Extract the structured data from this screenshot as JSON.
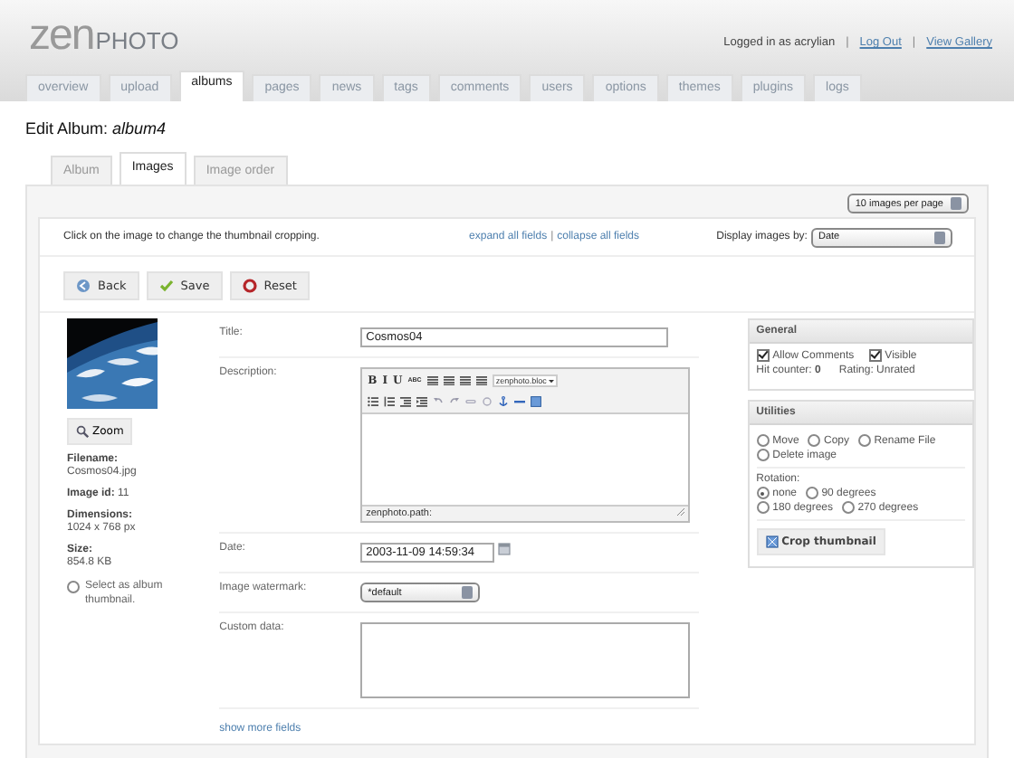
{
  "header": {
    "logo_light": "zen",
    "logo_bold": "PHOTO",
    "user_text": "Logged in as acrylian",
    "links": [
      {
        "separator": "|",
        "label": "Log Out"
      },
      {
        "separator": "|",
        "label": "View Gallery"
      }
    ]
  },
  "main_tabs": [
    {
      "label": "overview",
      "selected": false
    },
    {
      "label": "upload",
      "selected": false
    },
    {
      "label": "albums",
      "selected": true
    },
    {
      "label": "pages",
      "selected": false
    },
    {
      "label": "news",
      "selected": false
    },
    {
      "label": "tags",
      "selected": false
    },
    {
      "label": "comments",
      "selected": false
    },
    {
      "label": "users",
      "selected": false
    },
    {
      "label": "options",
      "selected": false
    },
    {
      "label": "themes",
      "selected": false
    },
    {
      "label": "plugins",
      "selected": false
    },
    {
      "label": "logs",
      "selected": false
    }
  ],
  "page_title": "Edit Album: *album4*",
  "sub_tabs": [
    {
      "label": "Album",
      "selected": false
    },
    {
      "label": "Images",
      "selected": true
    },
    {
      "label": "Image order",
      "selected": false
    }
  ],
  "per_page": "10 images per page",
  "instructions": "Click on the image to change the thumbnail cropping.",
  "field_links": [
    {
      "label": "expand all fields"
    },
    {
      "separator": "|",
      "label": "collapse all fields"
    }
  ],
  "display_by": {
    "label": "Display images by:",
    "value": "Date"
  },
  "buttons": [
    {
      "label": "Back",
      "kind": "back"
    },
    {
      "label": "Save",
      "kind": "save"
    },
    {
      "label": "Reset",
      "kind": "reset"
    }
  ],
  "image": {
    "kind": "picture",
    "zoom": "Zoom",
    "info": [
      {
        "label": "Filename:",
        "value": "Cosmos04.jpg",
        "inline": false
      },
      {
        "label": "Image id:",
        "value": "11",
        "inline": true
      },
      {
        "label": "Dimensions:",
        "value": "1024 x 768 px",
        "inline": false
      },
      {
        "label": "Size:",
        "value": "854.8 KB",
        "inline": false
      }
    ],
    "thumbnail_option": {
      "label": "Select as album thumbnail.",
      "selected": false
    }
  },
  "fields": [
    {
      "kind": "text",
      "label": "Title:",
      "value": "Cosmos04"
    },
    {
      "kind": "editor",
      "label": "Description:",
      "toolbar_text": [
        "B",
        "I",
        "U",
        "ABC"
      ],
      "format": "zenphoto.bloc",
      "path": "zenphoto.path:"
    },
    {
      "kind": "date",
      "label": "Date:",
      "value": "2003-11-09 14:59:34"
    },
    {
      "kind": "select",
      "label": "Image watermark:",
      "value": "*default"
    },
    {
      "kind": "textarea",
      "label": "Custom data:"
    }
  ],
  "show_more": "show more fields",
  "general": {
    "title": "General",
    "checks": [
      {
        "label": "Allow Comments",
        "checked": true
      },
      {
        "label": "Visible",
        "checked": true
      }
    ],
    "hit_counter": "Hit counter: **0**",
    "rating": "Rating: Unrated"
  },
  "utilities": {
    "title": "Utilities",
    "actions": [
      {
        "label": "Move",
        "selected": false
      },
      {
        "label": "Copy",
        "selected": false
      },
      {
        "label": "Rename File",
        "selected": false
      },
      {
        "label": "Delete image",
        "selected": false
      }
    ],
    "rotation_label": "Rotation:",
    "rotations": [
      {
        "label": "none",
        "selected": true
      },
      {
        "label": "90 degrees",
        "selected": false
      },
      {
        "label": "180 degrees",
        "selected": false
      },
      {
        "label": "270 degrees",
        "selected": false
      }
    ],
    "crop": "Crop thumbnail"
  }
}
